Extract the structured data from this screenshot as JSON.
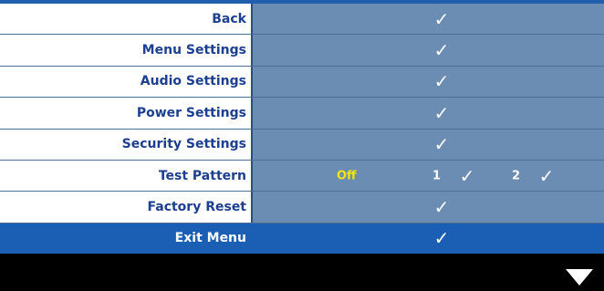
{
  "menu": {
    "items": [
      {
        "label": "Back",
        "check": "✓"
      },
      {
        "label": "Menu Settings",
        "check": "✓"
      },
      {
        "label": "Audio Settings",
        "check": "✓"
      },
      {
        "label": "Power Settings",
        "check": "✓"
      },
      {
        "label": "Security Settings",
        "check": "✓"
      },
      {
        "label": "Test Pattern",
        "off": "Off",
        "opt1": "1",
        "opt1_check": "✓",
        "opt2": "2",
        "opt2_check": "✓"
      },
      {
        "label": "Factory Reset",
        "check": "✓"
      },
      {
        "label": "Exit Menu",
        "check": "✓",
        "selected": true
      }
    ]
  },
  "colors": {
    "label_bg": "#ffffff",
    "label_text": "#1d3f8f",
    "value_bg": "#6b8cb3",
    "selected_bg": "#1a5fb4",
    "off_text": "#f5e600"
  },
  "icons": {
    "scroll_indicator": "triangle-down-icon"
  }
}
